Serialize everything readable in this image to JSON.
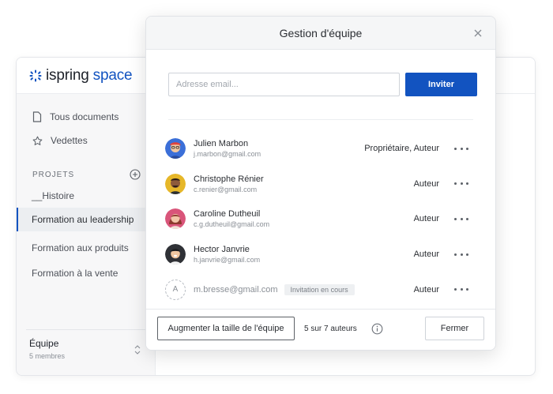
{
  "brand": {
    "name_part1": "ispring",
    "name_part2": " space",
    "accent_color": "#1253c0"
  },
  "sidebar": {
    "nav": [
      {
        "label": "Tous documents",
        "icon": "document-icon"
      },
      {
        "label": "Vedettes",
        "icon": "star-icon"
      }
    ],
    "section_title": "PROJETS",
    "projects": [
      {
        "label": "__Histoire",
        "active": false
      },
      {
        "label": "Formation au leadership",
        "active": true
      },
      {
        "label": "Formation aux produits",
        "active": false
      },
      {
        "label": "Formation à la vente",
        "active": false
      }
    ],
    "team": {
      "title": "Équipe",
      "subtitle": "5 membres"
    }
  },
  "modal": {
    "title": "Gestion d'équipe",
    "email_placeholder": "Adresse email...",
    "invite_label": "Inviter",
    "members": [
      {
        "name": "Julien Marbon",
        "email": "j.marbon@gmail.com",
        "role": "Propriétaire, Auteur",
        "avatar_color": "#3b6fd8"
      },
      {
        "name": "Christophe Rénier",
        "email": "c.renier@gmail.com",
        "role": "Auteur",
        "avatar_color": "#e6b729"
      },
      {
        "name": "Caroline Dutheuil",
        "email": "c.g.dutheuil@gmail.com",
        "role": "Auteur",
        "avatar_color": "#d9557a"
      },
      {
        "name": "Hector Janvrie",
        "email": "h.janvrie@gmail.com",
        "role": "Auteur",
        "avatar_color": "#2f3136"
      }
    ],
    "pending": {
      "initial": "A",
      "email": "m.bresse@gmail.com",
      "badge": "Invitation en cours",
      "role": "Auteur"
    },
    "footer": {
      "grow_label": "Augmenter la taille de l'équipe",
      "seats": "5 sur 7 auteurs",
      "close_label": "Fermer"
    }
  }
}
